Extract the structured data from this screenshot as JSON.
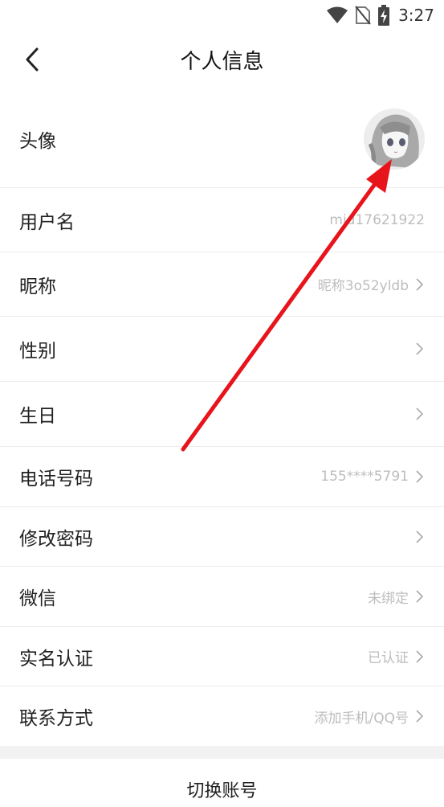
{
  "status_bar": {
    "time": "3:27"
  },
  "header": {
    "title": "个人信息"
  },
  "rows": [
    {
      "label": "头像",
      "value": ""
    },
    {
      "label": "用户名",
      "value": "mid17621922"
    },
    {
      "label": "昵称",
      "value": "昵称3o52yldb"
    },
    {
      "label": "性别",
      "value": ""
    },
    {
      "label": "生日",
      "value": ""
    },
    {
      "label": "电话号码",
      "value": "155****5791"
    },
    {
      "label": "修改密码",
      "value": ""
    },
    {
      "label": "微信",
      "value": "未绑定"
    },
    {
      "label": "实名认证",
      "value": "已认证"
    },
    {
      "label": "联系方式",
      "value": "添加手机/QQ号"
    }
  ],
  "footer": {
    "switch_account": "切换账号"
  },
  "colors": {
    "annotation": "#e8141b",
    "secondary_text": "#bdbdbd",
    "divider": "#ececec"
  }
}
